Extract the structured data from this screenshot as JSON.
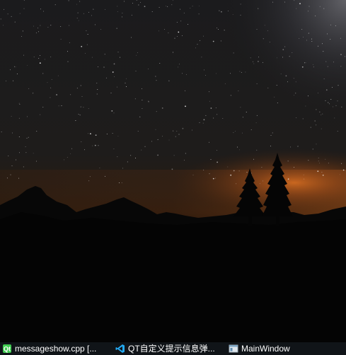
{
  "taskbar": {
    "items": [
      {
        "label": "messageshow.cpp [...",
        "icon": "qt-creator-icon"
      },
      {
        "label": "QT自定义提示信息弹...",
        "icon": "vscode-icon"
      },
      {
        "label": "MainWindow",
        "icon": "window-app-icon"
      }
    ]
  },
  "colors": {
    "taskbar_bg": "#101418",
    "sky_top": "#1a1a1c",
    "horizon_glow": "#c8641e",
    "silhouette": "#050505"
  }
}
